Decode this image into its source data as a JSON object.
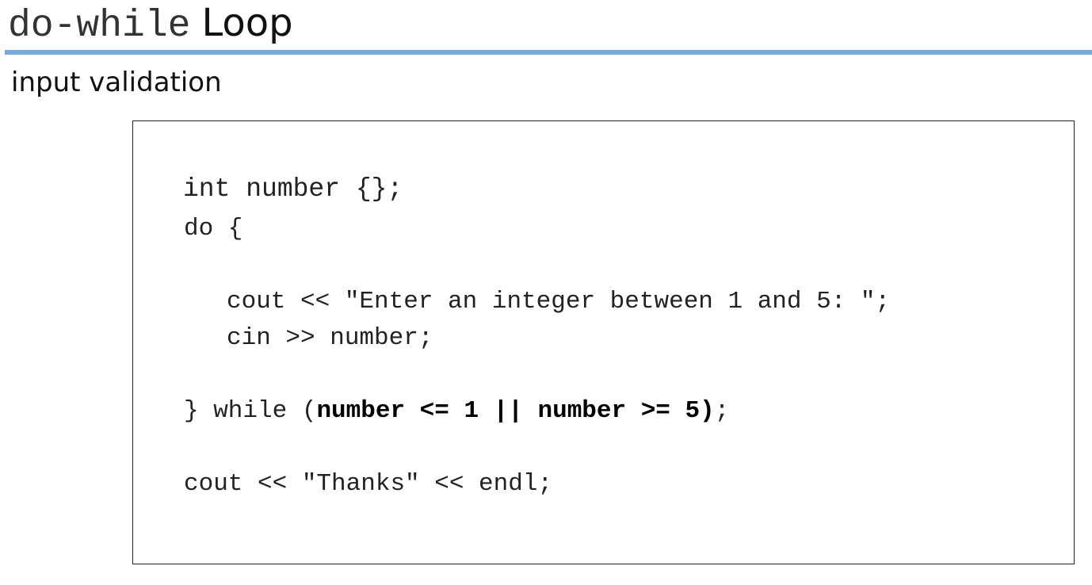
{
  "title": {
    "code": "do-while",
    "word": "Loop"
  },
  "subtitle": "input validation",
  "code": {
    "line1": "int number {};",
    "line2": "do {",
    "line3": "cout << \"Enter an integer between 1 and 5: \";",
    "line4": "cin >> number;",
    "line5": {
      "prefix": "} while (",
      "condition": "number <= 1 || number >= 5)",
      "suffix": ";"
    },
    "line6": "cout << \"Thanks\" << endl;"
  }
}
